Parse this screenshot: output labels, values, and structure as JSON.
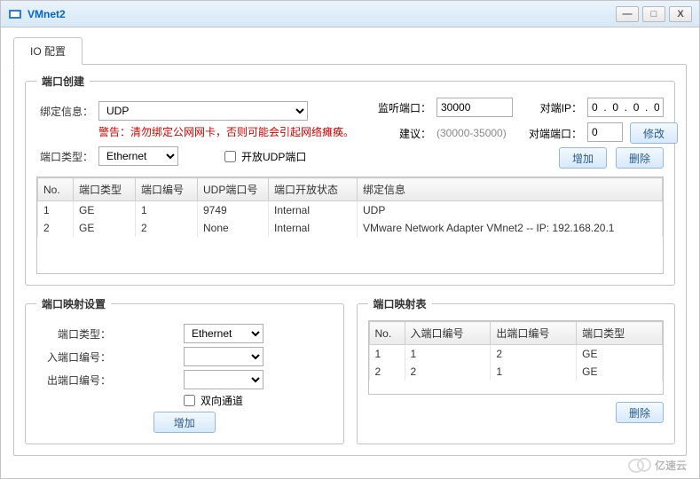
{
  "window": {
    "title": "VMnet2",
    "min": "—",
    "max": "□",
    "close": "X"
  },
  "tab": {
    "label": "IO 配置"
  },
  "portCreate": {
    "legend": "端口创建",
    "bindLabel": "绑定信息：",
    "bindValue": "UDP",
    "warningLabel": "警告：",
    "warningText": "清勿绑定公网网卡，否则可能会引起网络瘫痪。",
    "portTypeLabel": "端口类型：",
    "portTypeValue": "Ethernet",
    "openUdpLabel": "开放UDP端口",
    "listenLabel": "监听端口：",
    "listenValue": "30000",
    "hintLabel": "建议：",
    "hintText": "(30000-35000)",
    "peerIpLabel": "对端IP：",
    "peerIpValue": "0  .  0  .  0  .  0",
    "peerPortLabel": "对端端口：",
    "peerPortValue": "0",
    "btnModify": "修改",
    "btnAdd": "增加",
    "btnDelete": "删除"
  },
  "portTable": {
    "headers": [
      "No.",
      "端口类型",
      "端口编号",
      "UDP端口号",
      "端口开放状态",
      "绑定信息"
    ],
    "rows": [
      {
        "no": "1",
        "type": "GE",
        "idx": "1",
        "udp": "9749",
        "open": "Internal",
        "bind": "UDP"
      },
      {
        "no": "2",
        "type": "GE",
        "idx": "2",
        "udp": "None",
        "open": "Internal",
        "bind": "VMware Network Adapter VMnet2 -- IP: 192.168.20.1"
      }
    ]
  },
  "mapSetting": {
    "legend": "端口映射设置",
    "portTypeLabel": "端口类型：",
    "portTypeValue": "Ethernet",
    "inLabel": "入端口编号：",
    "outLabel": "出端口编号：",
    "bidirLabel": "双向通道",
    "btnAdd": "增加"
  },
  "mapTable": {
    "legend": "端口映射表",
    "headers": [
      "No.",
      "入端口编号",
      "出端口编号",
      "端口类型"
    ],
    "rows": [
      {
        "no": "1",
        "in": "1",
        "out": "2",
        "type": "GE"
      },
      {
        "no": "2",
        "in": "2",
        "out": "1",
        "type": "GE"
      }
    ],
    "btnDelete": "删除"
  },
  "watermark": "亿速云"
}
